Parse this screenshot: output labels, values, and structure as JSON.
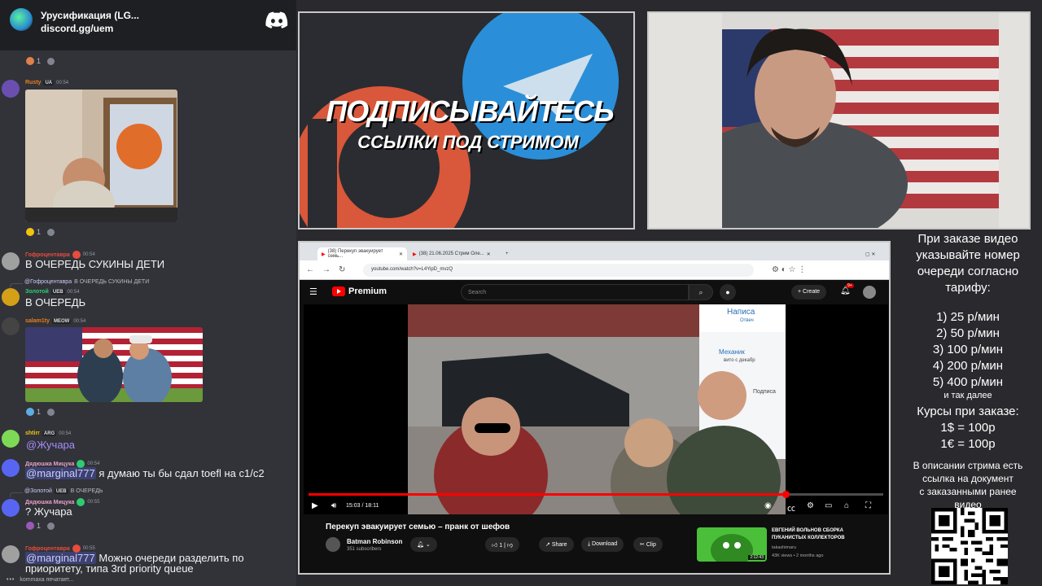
{
  "discord": {
    "server_name": "Урусификация (LG...",
    "invite": "discord.gg/uem",
    "messages": [
      {
        "user": "Rusty",
        "tag": "UA",
        "time": "00:54",
        "reaction_count": "1"
      },
      {
        "user": "Гофроцентавра",
        "time": "00:54",
        "text": "В ОЧЕРЕДЬ СУКИНЫ ДЕТИ",
        "reaction_count": "1"
      },
      {
        "reply_to": "@Гофроцентавра",
        "reply_text": "В ОЧЕРЕДЬ СУКИНЫ ДЕТИ",
        "user": "Золотой",
        "tag": "UEB",
        "time": "00:54",
        "text": "В ОЧЕРЕДЬ"
      },
      {
        "user": "salam1ty",
        "tag": "MEOW",
        "time": "00:54",
        "reaction_count": "1"
      },
      {
        "user": "shtirr",
        "tag": "ARG",
        "time": "00:54",
        "text": "@Жучара"
      },
      {
        "user": "Дядюшка Мицука",
        "time": "00:54",
        "mention": "@marginal777",
        "text": " я думаю ты бы сдал toefl на c1/c2"
      },
      {
        "reply_to": "@Золотой",
        "reply_tag": "UEB",
        "reply_text": "В ОЧЕРЕДЬ",
        "user": "Дядюшка Мицука",
        "time": "00:55",
        "text": "? Жучара",
        "reaction_count": "1"
      },
      {
        "user": "Гофроцентавра",
        "time": "00:55",
        "mention": "@marginal777",
        "text": " Можно очереди разделить по",
        "text2": "приоритету, типа 3rd priority queue"
      }
    ],
    "typing": "kommaxa печатает..."
  },
  "promo": {
    "title": "ПОДПИСЫВАЙТЕСЬ",
    "subtitle": "ССЫЛКИ ПОД СТРИМОМ"
  },
  "browser": {
    "tab1": "(38) Перекуп эвакуирует семь...",
    "tab2": "(38) 21.06.2025 Стрим Оле...",
    "url": "youtube.com/watch?v=L4YipD_mvzQ",
    "logo": "Premium",
    "search_placeholder": "Search",
    "create": "Create",
    "notif_count": "9+",
    "time": "15:03 / 18:11",
    "progress": 0.83,
    "video_title": "Перекуп эвакуирует семью – пранк от шефов",
    "channel": "Batman Robinson",
    "subscribers": "351 subscribers",
    "likes": "1",
    "share": "Share",
    "download": "Download",
    "clip": "Clip",
    "rec_title": "ЕВГЕНИЙ ВОЛЬНОВ СБОРКА ПУКАНИСТЫХ КОЛЛЕКТОРОВ",
    "rec_channel": "takashimaru",
    "rec_meta": "43K views • 2 months ago",
    "rec_duration": "2:12:43",
    "frame_text1": "Написа",
    "frame_text2": "Отвеч",
    "frame_text3": "Механик",
    "frame_text4": "вито с декабр",
    "frame_text5": "Подписа"
  },
  "info": {
    "intro": [
      "При заказе видео",
      "указывайте номер",
      "очереди согласно",
      "тарифу:"
    ],
    "tariffs": [
      "1) 25 р/мин",
      "2) 50 р/мин",
      "3) 100 р/мин",
      "4) 200 р/мин",
      "5) 400 р/мин"
    ],
    "etc": "и так далее",
    "rates_title": "Курсы при заказе:",
    "rates": [
      "1$ = 100р",
      "1€ = 100р"
    ],
    "note": [
      "В описании стрима есть",
      "ссылка на документ",
      "с заказанными ранее",
      "видео"
    ]
  }
}
